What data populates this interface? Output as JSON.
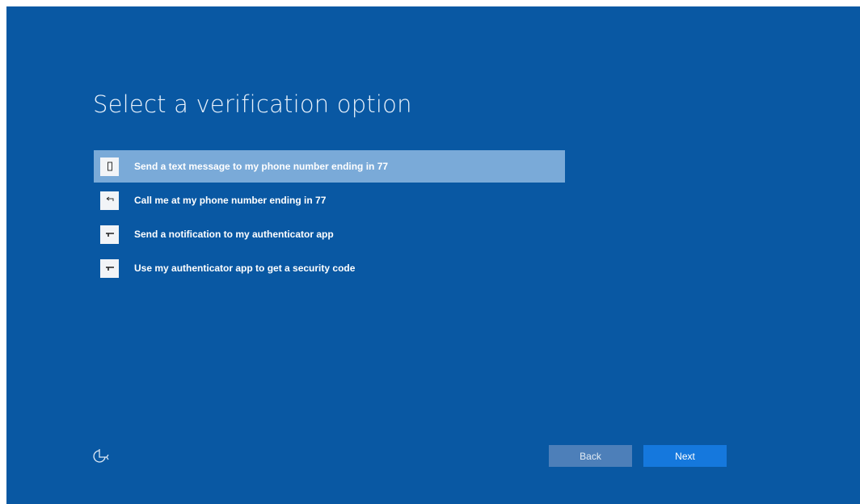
{
  "screen": {
    "title": "Select a verification option"
  },
  "options": [
    {
      "label": "Send a text message to my phone number ending in 77",
      "icon": "phone-text-icon",
      "selected": true
    },
    {
      "label": "Call me at my phone number ending in 77",
      "icon": "phone-call-icon",
      "selected": false
    },
    {
      "label": "Send a notification to my authenticator app",
      "icon": "authenticator-notification-icon",
      "selected": false
    },
    {
      "label": "Use my authenticator app to get a security code",
      "icon": "authenticator-code-icon",
      "selected": false
    }
  ],
  "footer": {
    "accessibility_icon": "ease-of-access-icon",
    "back_label": "Back",
    "next_label": "Next"
  },
  "colors": {
    "background": "#0958a3",
    "selected_row": "#7aaad8",
    "back_button": "#4d7fb9",
    "next_button": "#1578dd"
  }
}
